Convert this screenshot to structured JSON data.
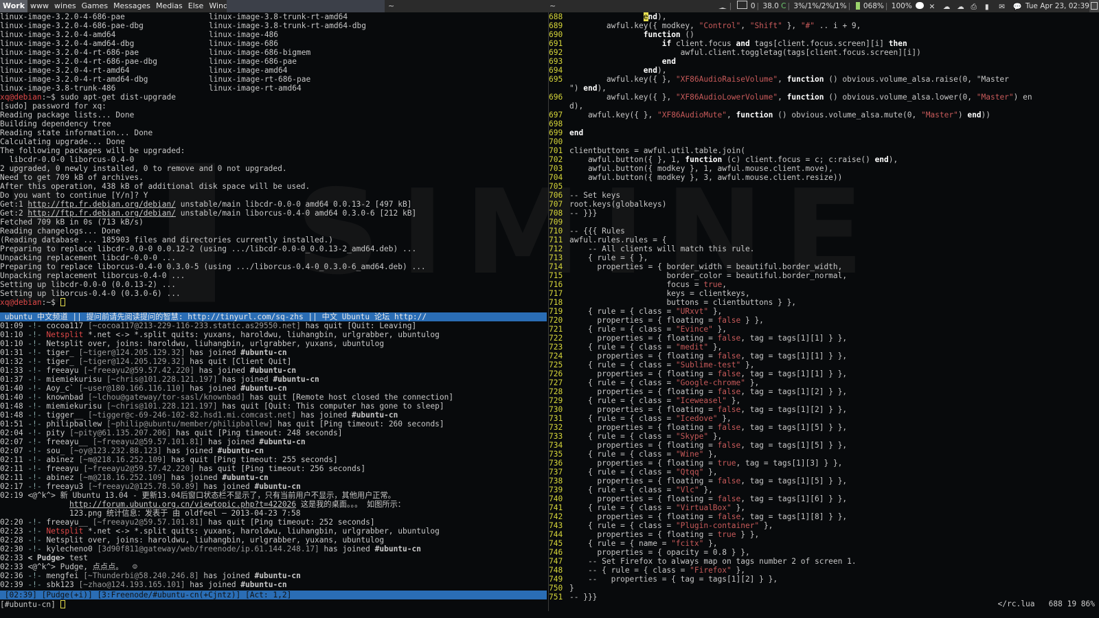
{
  "topbar": {
    "tags": [
      "Work",
      "www",
      "wines",
      "Games",
      "Messages",
      "Medias",
      "Else",
      "Windows",
      "~"
    ],
    "selected_tag": "Work",
    "task_tilde_2": "~",
    "task_tilde_3": "~",
    "status": {
      "mail_count": "0",
      "temp": "38.0",
      "temp_unit": "C",
      "cpu": "3%/1%/2%/1%",
      "mem": "068%",
      "battery": "100%",
      "datetime": "Tue Apr 23, 02:39"
    }
  },
  "terminal": {
    "apt_list": [
      [
        "linux-image-3.2.0-4-686-pae",
        "linux-image-3.8-trunk-rt-amd64"
      ],
      [
        "linux-image-3.2.0-4-686-pae-dbg",
        "linux-image-3.8-trunk-rt-amd64-dbg"
      ],
      [
        "linux-image-3.2.0-4-amd64",
        "linux-image-486"
      ],
      [
        "linux-image-3.2.0-4-amd64-dbg",
        "linux-image-686"
      ],
      [
        "linux-image-3.2.0-4-rt-686-pae",
        "linux-image-686-bigmem"
      ],
      [
        "linux-image-3.2.0-4-rt-686-pae-dbg",
        "linux-image-686-pae"
      ],
      [
        "linux-image-3.2.0-4-rt-amd64",
        "linux-image-amd64"
      ],
      [
        "linux-image-3.2.0-4-rt-amd64-dbg",
        "linux-image-rt-686-pae"
      ],
      [
        "linux-image-3.8-trunk-486",
        "linux-image-rt-amd64"
      ]
    ],
    "prompt_user": "xq@debian",
    "prompt_rest": ":~$ ",
    "command": "sudo apt-get dist-upgrade",
    "output": [
      "[sudo] password for xq:",
      "Reading package lists... Done",
      "Building dependency tree",
      "Reading state information... Done",
      "Calculating upgrade... Done",
      "The following packages will be upgraded:",
      "  libcdr-0.0-0 liborcus-0.4-0",
      "2 upgraded, 0 newly installed, 0 to remove and 0 not upgraded.",
      "Need to get 709 kB of archives.",
      "After this operation, 438 kB of additional disk space will be used.",
      "Do you want to continue [Y/n]? Y"
    ],
    "get1_prefix": "Get:1 ",
    "get1_url": "http://ftp.fr.debian.org/debian/",
    "get1_rest": " unstable/main libcdr-0.0-0 amd64 0.0.13-2 [497 kB]",
    "get2_prefix": "Get:2 ",
    "get2_url": "http://ftp.fr.debian.org/debian/",
    "get2_rest": " unstable/main liborcus-0.4-0 amd64 0.3.0-6 [212 kB]",
    "output2": [
      "Fetched 709 kB in 0s (713 kB/s)",
      "Reading changelogs... Done",
      "(Reading database ... 185903 files and directories currently installed.)",
      "Preparing to replace libcdr-0.0-0 0.0.12-2 (using .../libcdr-0.0-0_0.0.13-2_amd64.deb) ...",
      "Unpacking replacement libcdr-0.0-0 ...",
      "Preparing to replace liborcus-0.4-0 0.3.0-5 (using .../liborcus-0.4-0_0.3.0-6_amd64.deb) ...",
      "Unpacking replacement liborcus-0.4-0 ...",
      "Setting up libcdr-0.0-0 (0.0.13-2) ...",
      "Setting up liborcus-0.4-0 (0.3.0-6) ..."
    ]
  },
  "irc": {
    "topic": " ubuntu 中文频道 || 提问前请先阅读提问的智慧: http://tinyurl.com/sq-zhs || 中文 Ubuntu 论坛 http://",
    "lines": [
      {
        "time": "01:09",
        "nick": "cocoa117",
        "host": "[~cocoa117@213-229-116-233.static.as29550.net]",
        "text": " has quit [Quit: Leaving]"
      },
      {
        "time": "01:10",
        "nick": "Netsplit",
        "red": true,
        "host": "",
        "text": " *.net <-> *.split quits: yuxans, haroldwu, liuhangbin, urlgrabber, ubuntulog"
      },
      {
        "time": "01:10",
        "nick": "",
        "host": "",
        "text": "Netsplit over, joins: haroldwu, liuhangbin, urlgrabber, yuxans, ubuntulog"
      },
      {
        "time": "01:31",
        "nick": "tiger_",
        "host": "[~tiger@124.205.129.32]",
        "text": " has joined ",
        "chan": "#ubuntu-cn"
      },
      {
        "time": "01:32",
        "nick": "tiger_",
        "host": "[~tiger@124.205.129.32]",
        "text": " has quit [Client Quit]"
      },
      {
        "time": "01:33",
        "nick": "freeayu",
        "host": "[~freeayu2@59.57.42.220]",
        "text": " has joined ",
        "chan": "#ubuntu-cn"
      },
      {
        "time": "01:37",
        "nick": "miemiekurisu",
        "host": "[~chris@101.228.121.197]",
        "text": " has joined ",
        "chan": "#ubuntu-cn"
      },
      {
        "time": "01:40",
        "nick": "Aoy_c`",
        "host": "[~user@180.166.116.110]",
        "text": " has joined ",
        "chan": "#ubuntu-cn"
      },
      {
        "time": "01:40",
        "nick": "knownbad",
        "host": "[~lchou@gateway/tor-sasl/knownbad]",
        "text": " has quit [Remote host closed the connection]"
      },
      {
        "time": "01:48",
        "nick": "miemiekurisu",
        "host": "[~chris@101.228.121.197]",
        "text": " has quit [Quit: This computer has gone to sleep]"
      },
      {
        "time": "01:48",
        "nick": "tigger__",
        "host": "[~tigger@c-69-246-102-82.hsd1.mi.comcast.net]",
        "text": " has joined ",
        "chan": "#ubuntu-cn"
      },
      {
        "time": "01:51",
        "nick": "philipballew",
        "host": "[~philip@ubuntu/member/philipballew]",
        "text": " has quit [Ping timeout: 260 seconds]"
      },
      {
        "time": "02:04",
        "nick": "pity",
        "host": "[~pity@61.135.207.206]",
        "text": " has quit [Ping timeout: 248 seconds]"
      },
      {
        "time": "02:07",
        "nick": "freeayu__",
        "host": "[~freeayu2@59.57.101.81]",
        "text": " has joined ",
        "chan": "#ubuntu-cn"
      },
      {
        "time": "02:07",
        "nick": "sou_",
        "host": "[~oy@123.232.88.123]",
        "text": " has joined ",
        "chan": "#ubuntu-cn"
      },
      {
        "time": "02:11",
        "nick": "abinez",
        "host": "[~m@218.16.252.109]",
        "text": " has quit [Ping timeout: 255 seconds]"
      },
      {
        "time": "02:11",
        "nick": "freeayu",
        "host": "[~freeayu2@59.57.42.220]",
        "text": " has quit [Ping timeout: 256 seconds]"
      },
      {
        "time": "02:11",
        "nick": "abinez",
        "host": "[~m@218.16.252.109]",
        "text": " has joined ",
        "chan": "#ubuntu-cn"
      },
      {
        "time": "02:17",
        "nick": "freeayu3",
        "host": "[~freeayu2@125.78.50.89]",
        "text": " has joined ",
        "chan": "#ubuntu-cn"
      }
    ],
    "msg_time": "02:19",
    "msg_nick": "<@^k^>",
    "msg_text": " 新 Ubuntu 13.04 - 更新13.04后窗口状态栏不显示了，只有当前用户不显示，其他用户正常。",
    "msg_url": "http://forum.ubuntu.org.cn/viewtopic.php?t=422026",
    "msg_url_tail": " 这是我的桌面。。。 如图所示：",
    "msg_line3": "123.png 统计信息：发表于 由 oldfeel — 2013-04-23 7:58",
    "lines2": [
      {
        "time": "02:20",
        "nick": "freeayu__",
        "host": "[~freeayu2@59.57.101.81]",
        "text": " has quit [Ping timeout: 252 seconds]"
      },
      {
        "time": "02:23",
        "nick": "Netsplit",
        "red": true,
        "host": "",
        "text": " *.net <-> *.split quits: yuxans, haroldwu, liuhangbin, urlgrabber, ubuntulog"
      },
      {
        "time": "02:28",
        "nick": "",
        "host": "",
        "text": "Netsplit over, joins: haroldwu, liuhangbin, urlgrabber, yuxans, ubuntulog"
      },
      {
        "time": "02:30",
        "nick": "kylecheno0",
        "host": "[3d90f811@gateway/web/freenode/ip.61.144.248.17]",
        "text": " has joined ",
        "chan": "#ubuntu-cn"
      }
    ],
    "pudge1_time": "02:33",
    "pudge1_nick": "< Pudge>",
    "pudge1_text": " test",
    "pudge2_time": "02:33",
    "pudge2_nick": "<@^k^>",
    "pudge2_text": " Pudge, 点点点。  ☺",
    "lines3": [
      {
        "time": "02:36",
        "nick": "mengfei",
        "host": "[~Thunderbi@58.240.246.8]",
        "text": " has joined ",
        "chan": "#ubuntu-cn"
      },
      {
        "time": "02:39",
        "nick": "sbk123",
        "host": "[~zhao@124.193.165.101]",
        "text": " has joined ",
        "chan": "#ubuntu-cn"
      }
    ],
    "statusbar": " [02:39] [Pudge(+i)] [3:Freenode/#ubuntu-cn(+Cjntz)] [Act: 1,2]",
    "input_prompt": "[#ubuntu-cn] "
  },
  "editor": {
    "lines": [
      {
        "n": "688",
        "t": "                end),"
      },
      {
        "n": "689",
        "t": "        awful.key({ modkey, \"Control\", \"Shift\" }, \"#\" .. i + 9,"
      },
      {
        "n": "690",
        "t": "                function ()"
      },
      {
        "n": "691",
        "t": "                    if client.focus and tags[client.focus.screen][i] then"
      },
      {
        "n": "692",
        "t": "                        awful.client.toggletag(tags[client.focus.screen][i])"
      },
      {
        "n": "693",
        "t": "                    end"
      },
      {
        "n": "694",
        "t": "                end),"
      },
      {
        "n": "695",
        "t": "        awful.key({ }, \"XF86AudioRaiseVolume\", function () obvious.volume_alsa.raise(0, \"Master"
      },
      {
        "n": "",
        "t": "\") end),"
      },
      {
        "n": "696",
        "t": "        awful.key({ }, \"XF86AudioLowerVolume\", function () obvious.volume_alsa.lower(0, \"Master\") en"
      },
      {
        "n": "",
        "t": "d),"
      },
      {
        "n": "697",
        "t": "    awful.key({ }, \"XF86AudioMute\", function () obvious.volume_alsa.mute(0, \"Master\") end))"
      },
      {
        "n": "698",
        "t": ""
      },
      {
        "n": "699",
        "t": "end"
      },
      {
        "n": "700",
        "t": ""
      },
      {
        "n": "701",
        "t": "clientbuttons = awful.util.table.join("
      },
      {
        "n": "702",
        "t": "    awful.button({ }, 1, function (c) client.focus = c; c:raise() end),"
      },
      {
        "n": "703",
        "t": "    awful.button({ modkey }, 1, awful.mouse.client.move),"
      },
      {
        "n": "704",
        "t": "    awful.button({ modkey }, 3, awful.mouse.client.resize))"
      },
      {
        "n": "705",
        "t": ""
      },
      {
        "n": "706",
        "t": "-- Set keys"
      },
      {
        "n": "707",
        "t": "root.keys(globalkeys)"
      },
      {
        "n": "708",
        "t": "-- }}}"
      },
      {
        "n": "709",
        "t": ""
      },
      {
        "n": "710",
        "t": "-- {{{ Rules"
      },
      {
        "n": "711",
        "t": "awful.rules.rules = {"
      },
      {
        "n": "712",
        "t": "    -- All clients will match this rule."
      },
      {
        "n": "713",
        "t": "    { rule = { },"
      },
      {
        "n": "714",
        "t": "      properties = { border_width = beautiful.border_width,"
      },
      {
        "n": "715",
        "t": "                     border_color = beautiful.border_normal,"
      },
      {
        "n": "716",
        "t": "                     focus = true,"
      },
      {
        "n": "717",
        "t": "                     keys = clientkeys,"
      },
      {
        "n": "718",
        "t": "                     buttons = clientbuttons } },"
      },
      {
        "n": "719",
        "t": "    { rule = { class = \"URxvt\" },"
      },
      {
        "n": "720",
        "t": "      properties = { floating = false } },"
      },
      {
        "n": "721",
        "t": "    { rule = { class = \"Evince\" },"
      },
      {
        "n": "722",
        "t": "      properties = { floating = false, tag = tags[1][1] } },"
      },
      {
        "n": "723",
        "t": "    { rule = { class = \"medit\" },"
      },
      {
        "n": "724",
        "t": "      properties = { floating = false, tag = tags[1][1] } },"
      },
      {
        "n": "725",
        "t": "    { rule = { class = \"Sublime-test\" },"
      },
      {
        "n": "726",
        "t": "      properties = { floating = false, tag = tags[1][1] } },"
      },
      {
        "n": "727",
        "t": "    { rule = { class = \"Google-chrome\" },"
      },
      {
        "n": "728",
        "t": "      properties = { floating = false, tag = tags[1][2] } },"
      },
      {
        "n": "729",
        "t": "    { rule = { class = \"Iceweasel\" },"
      },
      {
        "n": "730",
        "t": "      properties = { floating = false, tag = tags[1][2] } },"
      },
      {
        "n": "731",
        "t": "    { rule = { class = \"Icedove\" },"
      },
      {
        "n": "732",
        "t": "      properties = { floating = false, tag = tags[1][5] } },"
      },
      {
        "n": "733",
        "t": "    { rule = { class = \"Skype\" },"
      },
      {
        "n": "734",
        "t": "      properties = { floating = false, tag = tags[1][5] } },"
      },
      {
        "n": "735",
        "t": "    { rule = { class = \"Wine\" },"
      },
      {
        "n": "736",
        "t": "      properties = { floating = true, tag = tags[1][3] } },"
      },
      {
        "n": "737",
        "t": "    { rule = { class = \"Qtqq\" },"
      },
      {
        "n": "738",
        "t": "      properties = { floating = false, tag = tags[1][5] } },"
      },
      {
        "n": "739",
        "t": "    { rule = { class = \"Vlc\" },"
      },
      {
        "n": "740",
        "t": "      properties = { floating = false, tag = tags[1][6] } },"
      },
      {
        "n": "741",
        "t": "    { rule = { class = \"VirtualBox\" },"
      },
      {
        "n": "742",
        "t": "      properties = { floating = false, tag = tags[1][8] } },"
      },
      {
        "n": "743",
        "t": "    { rule = { class = \"Plugin-container\" },"
      },
      {
        "n": "744",
        "t": "      properties = { floating = true } },"
      },
      {
        "n": "745",
        "t": "    { rule = { name = \"fcitx\" },"
      },
      {
        "n": "746",
        "t": "      properties = { opacity = 0.8 } },"
      },
      {
        "n": "747",
        "t": "    -- Set Firefox to always map on tags number 2 of screen 1."
      },
      {
        "n": "748",
        "t": "    -- { rule = { class = \"Firefox\" },"
      },
      {
        "n": "749",
        "t": "    --   properties = { tag = tags[1][2] } },"
      },
      {
        "n": "750",
        "t": "}"
      },
      {
        "n": "751",
        "t": "-- }}}"
      }
    ],
    "statusline": "</rc.lua   688 19 86%"
  }
}
